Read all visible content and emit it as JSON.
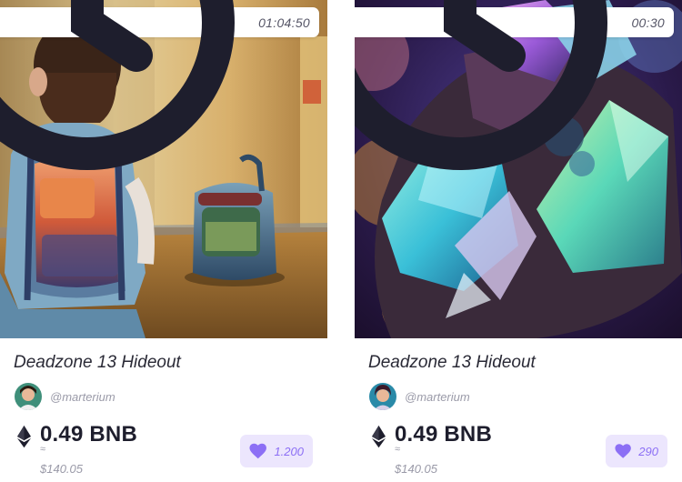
{
  "cards": [
    {
      "image": "girl-with-backpack-artwork",
      "timer": "01:04:50",
      "title": "Deadzone 13 Hideout",
      "creator": "@marterium",
      "price": "0.49 BNB",
      "approx": "≈",
      "usd": "$140.05",
      "likes": "1.200"
    },
    {
      "image": "glowing-crystals-artwork",
      "timer": "00:30",
      "title": "Deadzone 13 Hideout",
      "creator": "@marterium",
      "price": "0.49 BNB",
      "approx": "≈",
      "usd": "$140.05",
      "likes": "290"
    }
  ],
  "icons": {
    "timer": "clock-icon",
    "currency": "ethereum-icon",
    "like": "heart-icon"
  },
  "colors": {
    "accent": "#8c6ff5",
    "like_bg": "#ece6fd",
    "text": "#1e1e2d",
    "muted": "#9a9aa8"
  }
}
